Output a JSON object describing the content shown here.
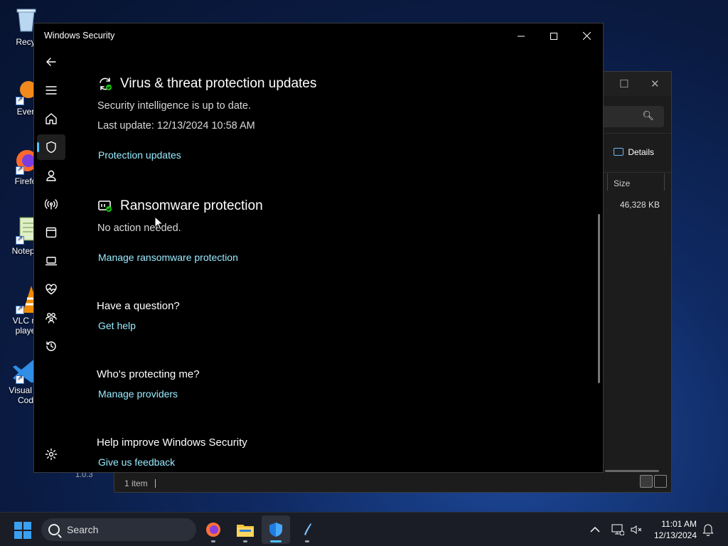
{
  "desktop": {
    "icons": [
      {
        "label": "Recy",
        "icon": "recycle-bin-icon"
      },
      {
        "label": "Ever",
        "icon": "everything-icon"
      },
      {
        "label": "Firefo",
        "icon": "firefox-icon"
      },
      {
        "label": "Notepa",
        "icon": "notepad-icon"
      },
      {
        "label": "VLC m\nplaye",
        "icon": "vlc-icon"
      },
      {
        "label": "Visual St\nCod",
        "icon": "vscode-icon"
      }
    ],
    "version_text": "1.0.3"
  },
  "explorer": {
    "details_label": "Details",
    "column_size": "Size",
    "file_size": "46,328 KB",
    "status": "1 item"
  },
  "security": {
    "window_title": "Windows Security",
    "nav": [
      {
        "name": "back-icon"
      },
      {
        "name": "menu-icon"
      },
      {
        "name": "home-icon"
      },
      {
        "name": "shield-icon",
        "active": true
      },
      {
        "name": "account-icon"
      },
      {
        "name": "network-icon"
      },
      {
        "name": "app-browser-icon"
      },
      {
        "name": "device-security-icon"
      },
      {
        "name": "health-icon"
      },
      {
        "name": "family-icon"
      },
      {
        "name": "history-icon"
      },
      {
        "name": "settings-icon"
      }
    ],
    "updates": {
      "title": "Virus & threat protection updates",
      "status": "Security intelligence is up to date.",
      "last_update": "Last update: 12/13/2024 10:58 AM",
      "link": "Protection updates"
    },
    "ransomware": {
      "title": "Ransomware protection",
      "status": "No action needed.",
      "link": "Manage ransomware protection"
    },
    "question": {
      "title": "Have a question?",
      "link": "Get help"
    },
    "protecting": {
      "title": "Who's protecting me?",
      "link": "Manage providers"
    },
    "improve": {
      "title": "Help improve Windows Security",
      "link": "Give us feedback"
    }
  },
  "taskbar": {
    "search_label": "Search",
    "apps": [
      "firefox-icon",
      "file-explorer-icon",
      "windows-security-icon",
      "pen-app-icon"
    ],
    "time": "11:01 AM",
    "date": "12/13/2024"
  },
  "colors": {
    "link": "#99ebff",
    "accent": "#4cc2ff",
    "window_bg": "#000000"
  }
}
